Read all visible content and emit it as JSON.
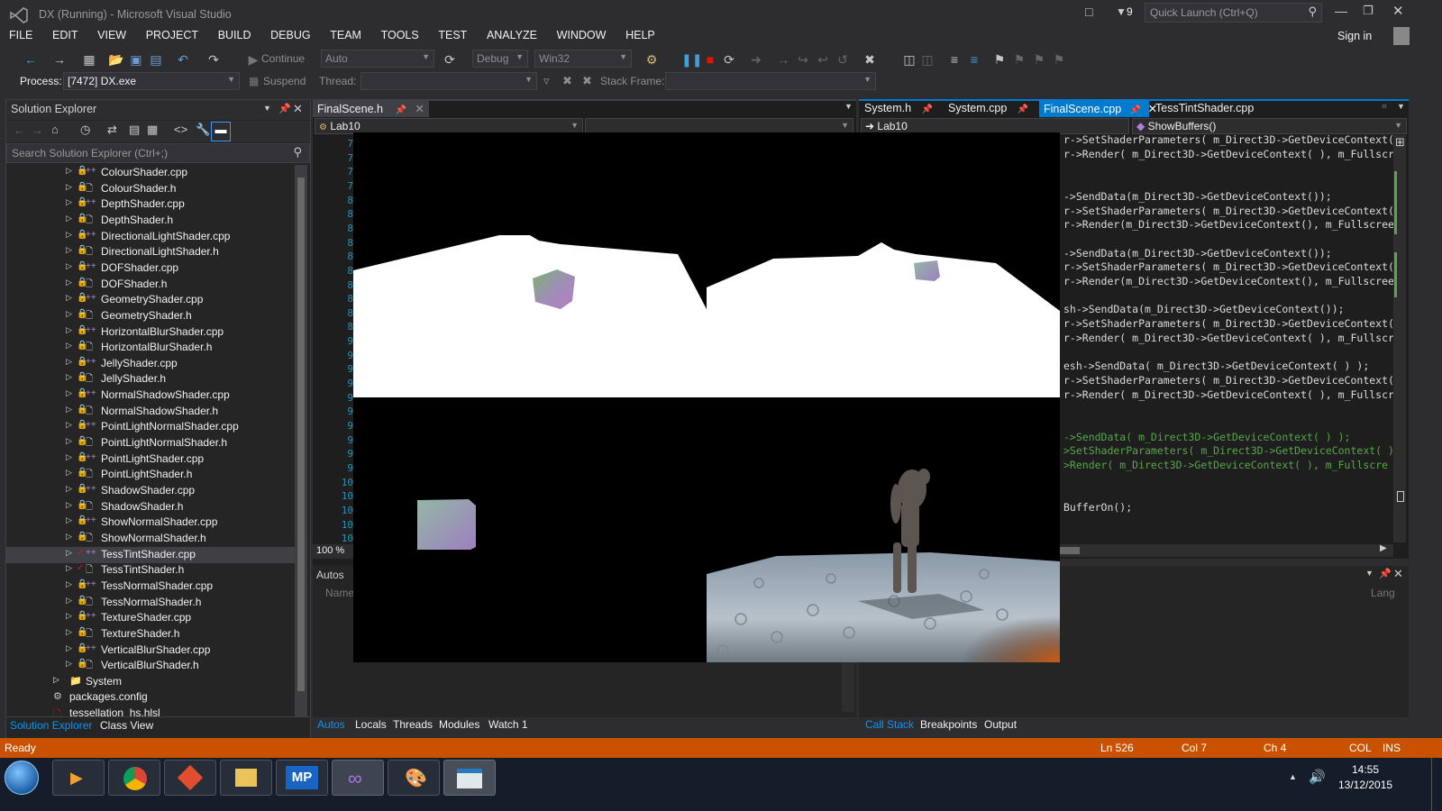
{
  "window": {
    "title": "DX (Running) - Microsoft Visual Studio",
    "notif_count": "9",
    "quick_launch_placeholder": "Quick Launch (Ctrl+Q)",
    "sign_in": "Sign in"
  },
  "menu": [
    "FILE",
    "EDIT",
    "VIEW",
    "PROJECT",
    "BUILD",
    "DEBUG",
    "TEAM",
    "TOOLS",
    "TEST",
    "ANALYZE",
    "WINDOW",
    "HELP"
  ],
  "toolbar": {
    "continue": "Continue",
    "config_auto": "Auto",
    "config_debug": "Debug",
    "platform": "Win32"
  },
  "debug_bar": {
    "process_label": "Process:",
    "process_value": "[7472] DX.exe",
    "suspend": "Suspend",
    "thread_label": "Thread:",
    "stack_frame_label": "Stack Frame:"
  },
  "solution_explorer": {
    "title": "Solution Explorer",
    "search_placeholder": "Search Solution Explorer (Ctrl+;)",
    "items": [
      {
        "name": "ColourShader.cpp",
        "type": "cpp"
      },
      {
        "name": "ColourShader.h",
        "type": "h"
      },
      {
        "name": "DepthShader.cpp",
        "type": "cpp"
      },
      {
        "name": "DepthShader.h",
        "type": "h"
      },
      {
        "name": "DirectionalLightShader.cpp",
        "type": "cpp"
      },
      {
        "name": "DirectionalLightShader.h",
        "type": "h"
      },
      {
        "name": "DOFShader.cpp",
        "type": "cpp"
      },
      {
        "name": "DOFShader.h",
        "type": "h"
      },
      {
        "name": "GeometryShader.cpp",
        "type": "cpp"
      },
      {
        "name": "GeometryShader.h",
        "type": "h"
      },
      {
        "name": "HorizontalBlurShader.cpp",
        "type": "cpp"
      },
      {
        "name": "HorizontalBlurShader.h",
        "type": "h"
      },
      {
        "name": "JellyShader.cpp",
        "type": "cpp"
      },
      {
        "name": "JellyShader.h",
        "type": "h"
      },
      {
        "name": "NormalShadowShader.cpp",
        "type": "cpp"
      },
      {
        "name": "NormalShadowShader.h",
        "type": "h"
      },
      {
        "name": "PointLightNormalShader.cpp",
        "type": "cpp"
      },
      {
        "name": "PointLightNormalShader.h",
        "type": "h"
      },
      {
        "name": "PointLightShader.cpp",
        "type": "cpp"
      },
      {
        "name": "PointLightShader.h",
        "type": "h"
      },
      {
        "name": "ShadowShader.cpp",
        "type": "cpp"
      },
      {
        "name": "ShadowShader.h",
        "type": "h"
      },
      {
        "name": "ShowNormalShader.cpp",
        "type": "cpp"
      },
      {
        "name": "ShowNormalShader.h",
        "type": "h"
      },
      {
        "name": "TessTintShader.cpp",
        "type": "cpp",
        "selected": true,
        "modified": true
      },
      {
        "name": "TessTintShader.h",
        "type": "h",
        "modified": true
      },
      {
        "name": "TessNormalShader.cpp",
        "type": "cpp"
      },
      {
        "name": "TessNormalShader.h",
        "type": "h"
      },
      {
        "name": "TextureShader.cpp",
        "type": "cpp"
      },
      {
        "name": "TextureShader.h",
        "type": "h"
      },
      {
        "name": "VerticalBlurShader.cpp",
        "type": "cpp"
      },
      {
        "name": "VerticalBlurShader.h",
        "type": "h"
      }
    ],
    "system_folder": "System",
    "packages": "packages.config",
    "hlsl": "tessellation_hs.hlsl",
    "tabs": [
      "Solution Explorer",
      "Class View"
    ]
  },
  "left_editor": {
    "tab": "FinalScene.h",
    "scope": "Lab10",
    "zoom": "100 %",
    "line_numbers": [
      "7",
      "7",
      "7",
      "7",
      "8",
      "8",
      "8",
      "8",
      "8",
      "8",
      "8",
      "8",
      "8",
      "8",
      "9",
      "9",
      "9",
      "9",
      "9",
      "9",
      "9",
      "9",
      "9",
      "9",
      "10",
      "10",
      "10",
      "10",
      "10"
    ]
  },
  "right_editor": {
    "tabs": [
      "System.h",
      "System.cpp",
      "FinalScene.cpp",
      "TessTintShader.cpp"
    ],
    "active_tab": "FinalScene.cpp",
    "scope": "Lab10",
    "member": "ShowBuffers()",
    "code": [
      {
        "text": "r->SetShaderParameters( m_Direct3D->GetDeviceContext(",
        "green": false
      },
      {
        "text": "r->Render( m_Direct3D->GetDeviceContext( ), m_Fullscre",
        "green": false
      },
      {
        "text": "",
        "green": false
      },
      {
        "text": "",
        "green": false
      },
      {
        "text": "->SendData(m_Direct3D->GetDeviceContext());",
        "green": false
      },
      {
        "text": "r->SetShaderParameters( m_Direct3D->GetDeviceContext(",
        "green": false
      },
      {
        "text": "r->Render(m_Direct3D->GetDeviceContext(), m_Fullscreen",
        "green": false
      },
      {
        "text": "",
        "green": false
      },
      {
        "text": "->SendData(m_Direct3D->GetDeviceContext());",
        "green": false
      },
      {
        "text": "r->SetShaderParameters( m_Direct3D->GetDeviceContext(",
        "green": false
      },
      {
        "text": "r->Render(m_Direct3D->GetDeviceContext(), m_Fullscreen",
        "green": false
      },
      {
        "text": "",
        "green": false
      },
      {
        "text": "sh->SendData(m_Direct3D->GetDeviceContext());",
        "green": false
      },
      {
        "text": "r->SetShaderParameters( m_Direct3D->GetDeviceContext(",
        "green": false
      },
      {
        "text": "r->Render( m_Direct3D->GetDeviceContext( ), m_Fullscre",
        "green": false
      },
      {
        "text": "",
        "green": false
      },
      {
        "text": "esh->SendData( m_Direct3D->GetDeviceContext( ) );",
        "green": false
      },
      {
        "text": "r->SetShaderParameters( m_Direct3D->GetDeviceContext(",
        "green": false
      },
      {
        "text": "r->Render( m_Direct3D->GetDeviceContext( ), m_Fullscre",
        "green": false
      },
      {
        "text": "",
        "green": false
      },
      {
        "text": "",
        "green": false
      },
      {
        "text": "->SendData( m_Direct3D->GetDeviceContext( ) );",
        "green": true
      },
      {
        "text": ">SetShaderParameters( m_Direct3D->GetDeviceContext( )",
        "green": true
      },
      {
        "text": ">Render( m_Direct3D->GetDeviceContext( ), m_Fullscre",
        "green": true
      },
      {
        "text": "",
        "green": false
      },
      {
        "text": "",
        "green": false
      },
      {
        "text": "BufferOn();",
        "green": false
      }
    ]
  },
  "bottom_left": {
    "title": "Autos",
    "column_name": "Name",
    "tabs": [
      "Autos",
      "Locals",
      "Threads",
      "Modules",
      "Watch 1"
    ]
  },
  "bottom_right": {
    "column_lang": "Lang",
    "tabs": [
      "Call Stack",
      "Breakpoints",
      "Output"
    ]
  },
  "status": {
    "ready": "Ready",
    "line": "Ln 526",
    "col": "Col 7",
    "ch": "Ch 4",
    "mode": "COL",
    "ins": "INS"
  },
  "clock": {
    "time": "14:55",
    "date": "13/12/2015"
  },
  "colors": {
    "accent": "#007acc",
    "status_bar": "#ca5100",
    "background": "#2d2d30"
  }
}
